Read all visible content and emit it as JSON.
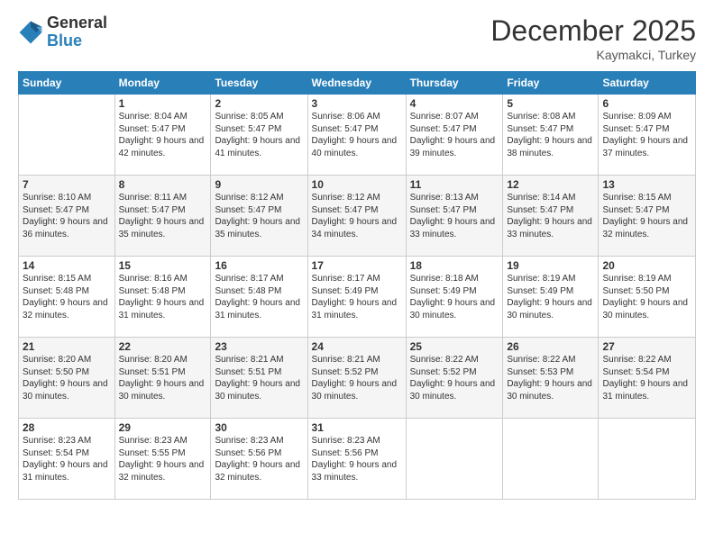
{
  "logo": {
    "general": "General",
    "blue": "Blue"
  },
  "title": "December 2025",
  "location": "Kaymakci, Turkey",
  "days_of_week": [
    "Sunday",
    "Monday",
    "Tuesday",
    "Wednesday",
    "Thursday",
    "Friday",
    "Saturday"
  ],
  "weeks": [
    [
      {
        "day": "",
        "sunrise": "",
        "sunset": "",
        "daylight": ""
      },
      {
        "day": "1",
        "sunrise": "Sunrise: 8:04 AM",
        "sunset": "Sunset: 5:47 PM",
        "daylight": "Daylight: 9 hours and 42 minutes."
      },
      {
        "day": "2",
        "sunrise": "Sunrise: 8:05 AM",
        "sunset": "Sunset: 5:47 PM",
        "daylight": "Daylight: 9 hours and 41 minutes."
      },
      {
        "day": "3",
        "sunrise": "Sunrise: 8:06 AM",
        "sunset": "Sunset: 5:47 PM",
        "daylight": "Daylight: 9 hours and 40 minutes."
      },
      {
        "day": "4",
        "sunrise": "Sunrise: 8:07 AM",
        "sunset": "Sunset: 5:47 PM",
        "daylight": "Daylight: 9 hours and 39 minutes."
      },
      {
        "day": "5",
        "sunrise": "Sunrise: 8:08 AM",
        "sunset": "Sunset: 5:47 PM",
        "daylight": "Daylight: 9 hours and 38 minutes."
      },
      {
        "day": "6",
        "sunrise": "Sunrise: 8:09 AM",
        "sunset": "Sunset: 5:47 PM",
        "daylight": "Daylight: 9 hours and 37 minutes."
      }
    ],
    [
      {
        "day": "7",
        "sunrise": "Sunrise: 8:10 AM",
        "sunset": "Sunset: 5:47 PM",
        "daylight": "Daylight: 9 hours and 36 minutes."
      },
      {
        "day": "8",
        "sunrise": "Sunrise: 8:11 AM",
        "sunset": "Sunset: 5:47 PM",
        "daylight": "Daylight: 9 hours and 35 minutes."
      },
      {
        "day": "9",
        "sunrise": "Sunrise: 8:12 AM",
        "sunset": "Sunset: 5:47 PM",
        "daylight": "Daylight: 9 hours and 35 minutes."
      },
      {
        "day": "10",
        "sunrise": "Sunrise: 8:12 AM",
        "sunset": "Sunset: 5:47 PM",
        "daylight": "Daylight: 9 hours and 34 minutes."
      },
      {
        "day": "11",
        "sunrise": "Sunrise: 8:13 AM",
        "sunset": "Sunset: 5:47 PM",
        "daylight": "Daylight: 9 hours and 33 minutes."
      },
      {
        "day": "12",
        "sunrise": "Sunrise: 8:14 AM",
        "sunset": "Sunset: 5:47 PM",
        "daylight": "Daylight: 9 hours and 33 minutes."
      },
      {
        "day": "13",
        "sunrise": "Sunrise: 8:15 AM",
        "sunset": "Sunset: 5:47 PM",
        "daylight": "Daylight: 9 hours and 32 minutes."
      }
    ],
    [
      {
        "day": "14",
        "sunrise": "Sunrise: 8:15 AM",
        "sunset": "Sunset: 5:48 PM",
        "daylight": "Daylight: 9 hours and 32 minutes."
      },
      {
        "day": "15",
        "sunrise": "Sunrise: 8:16 AM",
        "sunset": "Sunset: 5:48 PM",
        "daylight": "Daylight: 9 hours and 31 minutes."
      },
      {
        "day": "16",
        "sunrise": "Sunrise: 8:17 AM",
        "sunset": "Sunset: 5:48 PM",
        "daylight": "Daylight: 9 hours and 31 minutes."
      },
      {
        "day": "17",
        "sunrise": "Sunrise: 8:17 AM",
        "sunset": "Sunset: 5:49 PM",
        "daylight": "Daylight: 9 hours and 31 minutes."
      },
      {
        "day": "18",
        "sunrise": "Sunrise: 8:18 AM",
        "sunset": "Sunset: 5:49 PM",
        "daylight": "Daylight: 9 hours and 30 minutes."
      },
      {
        "day": "19",
        "sunrise": "Sunrise: 8:19 AM",
        "sunset": "Sunset: 5:49 PM",
        "daylight": "Daylight: 9 hours and 30 minutes."
      },
      {
        "day": "20",
        "sunrise": "Sunrise: 8:19 AM",
        "sunset": "Sunset: 5:50 PM",
        "daylight": "Daylight: 9 hours and 30 minutes."
      }
    ],
    [
      {
        "day": "21",
        "sunrise": "Sunrise: 8:20 AM",
        "sunset": "Sunset: 5:50 PM",
        "daylight": "Daylight: 9 hours and 30 minutes."
      },
      {
        "day": "22",
        "sunrise": "Sunrise: 8:20 AM",
        "sunset": "Sunset: 5:51 PM",
        "daylight": "Daylight: 9 hours and 30 minutes."
      },
      {
        "day": "23",
        "sunrise": "Sunrise: 8:21 AM",
        "sunset": "Sunset: 5:51 PM",
        "daylight": "Daylight: 9 hours and 30 minutes."
      },
      {
        "day": "24",
        "sunrise": "Sunrise: 8:21 AM",
        "sunset": "Sunset: 5:52 PM",
        "daylight": "Daylight: 9 hours and 30 minutes."
      },
      {
        "day": "25",
        "sunrise": "Sunrise: 8:22 AM",
        "sunset": "Sunset: 5:52 PM",
        "daylight": "Daylight: 9 hours and 30 minutes."
      },
      {
        "day": "26",
        "sunrise": "Sunrise: 8:22 AM",
        "sunset": "Sunset: 5:53 PM",
        "daylight": "Daylight: 9 hours and 30 minutes."
      },
      {
        "day": "27",
        "sunrise": "Sunrise: 8:22 AM",
        "sunset": "Sunset: 5:54 PM",
        "daylight": "Daylight: 9 hours and 31 minutes."
      }
    ],
    [
      {
        "day": "28",
        "sunrise": "Sunrise: 8:23 AM",
        "sunset": "Sunset: 5:54 PM",
        "daylight": "Daylight: 9 hours and 31 minutes."
      },
      {
        "day": "29",
        "sunrise": "Sunrise: 8:23 AM",
        "sunset": "Sunset: 5:55 PM",
        "daylight": "Daylight: 9 hours and 32 minutes."
      },
      {
        "day": "30",
        "sunrise": "Sunrise: 8:23 AM",
        "sunset": "Sunset: 5:56 PM",
        "daylight": "Daylight: 9 hours and 32 minutes."
      },
      {
        "day": "31",
        "sunrise": "Sunrise: 8:23 AM",
        "sunset": "Sunset: 5:56 PM",
        "daylight": "Daylight: 9 hours and 33 minutes."
      },
      {
        "day": "",
        "sunrise": "",
        "sunset": "",
        "daylight": ""
      },
      {
        "day": "",
        "sunrise": "",
        "sunset": "",
        "daylight": ""
      },
      {
        "day": "",
        "sunrise": "",
        "sunset": "",
        "daylight": ""
      }
    ]
  ]
}
